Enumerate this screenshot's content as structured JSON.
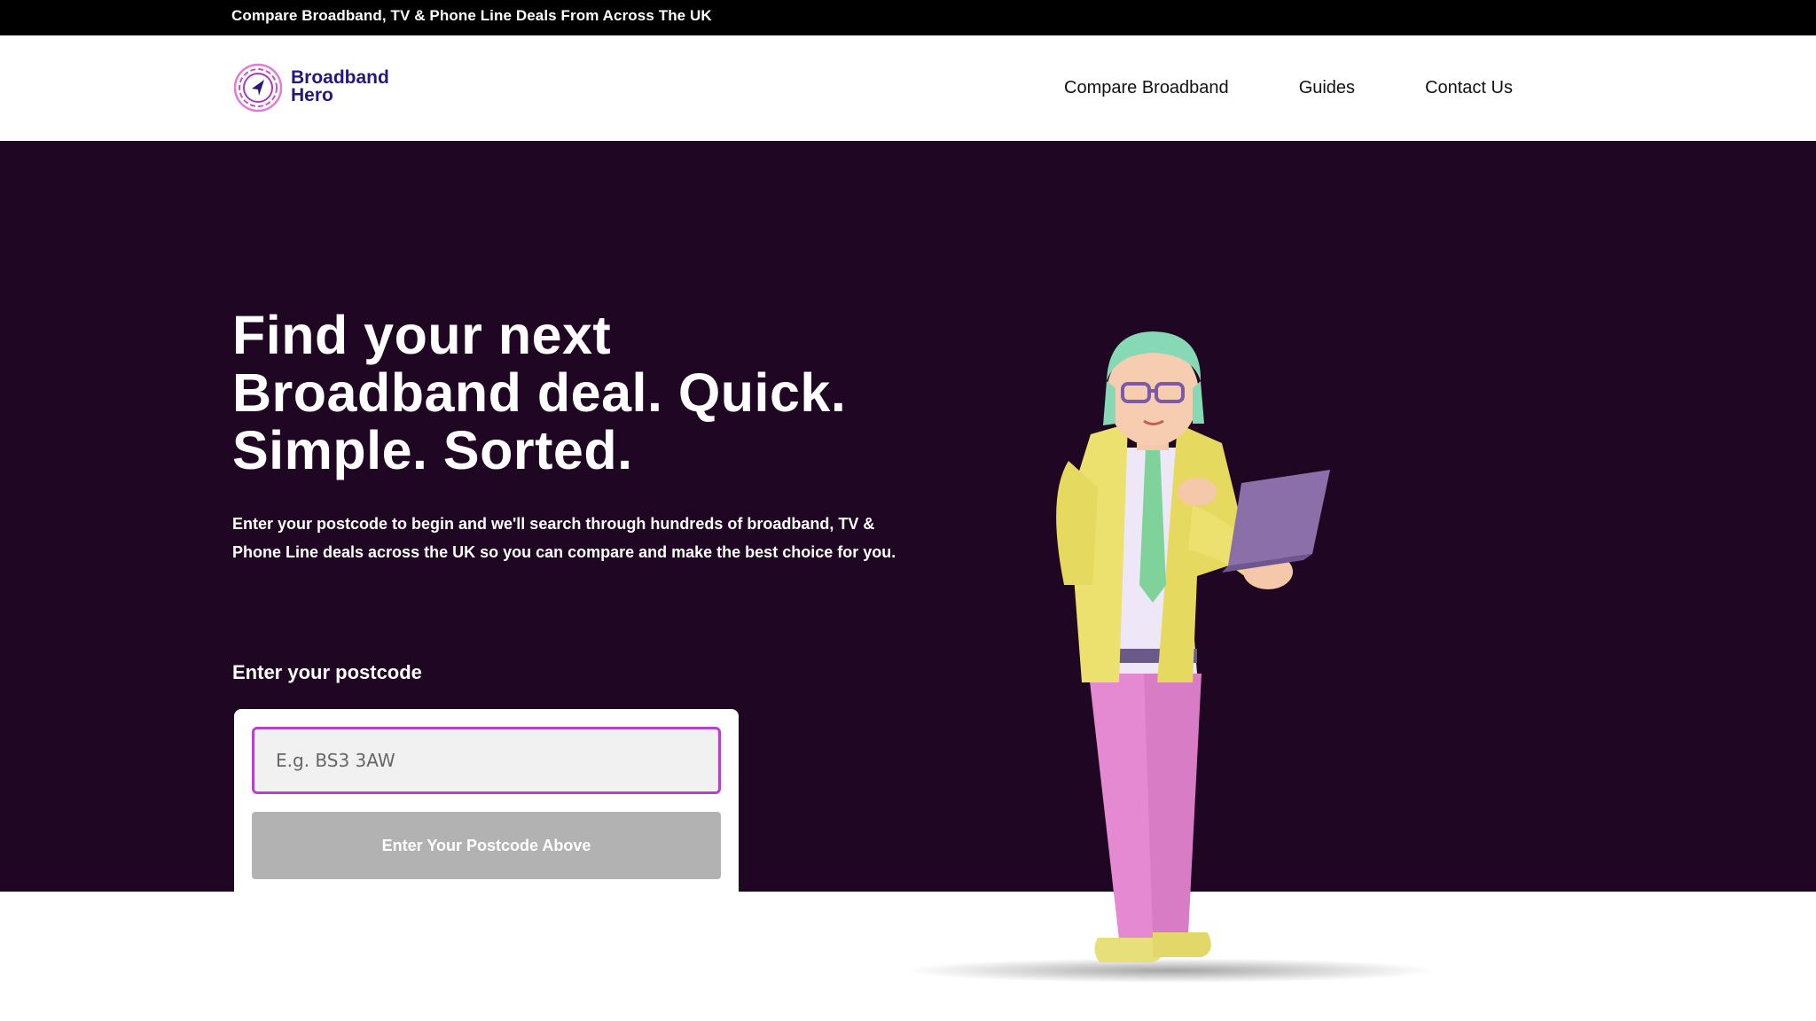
{
  "topbar": {
    "text": "Compare Broadband, TV & Phone Line Deals From Across The UK"
  },
  "brand": {
    "name_line1": "Broadband",
    "name_line2": "Hero",
    "logo_icon": "navigation-arrow-icon"
  },
  "nav": {
    "items": [
      {
        "label": "Compare Broadband"
      },
      {
        "label": "Guides"
      },
      {
        "label": "Contact Us"
      }
    ]
  },
  "hero": {
    "title_line1": "Find your next",
    "title_line2": "Broadband deal. Quick.",
    "title_line3": "Simple. Sorted.",
    "description": "Enter your postcode to begin and we'll search through hundreds of broadband, TV & Phone Line deals across the UK so you can compare and make the best choice for you.",
    "postcode_label": "Enter your postcode",
    "illustration": "man-with-laptop-illustration"
  },
  "form": {
    "postcode_placeholder": "E.g. BS3 3AW",
    "postcode_value": "",
    "submit_label": "Enter Your Postcode Above"
  },
  "colors": {
    "hero_background": "#1f0622",
    "brand_navy": "#22187e",
    "brand_accent": "#b542c8",
    "button_disabled": "#b2b2b2"
  }
}
